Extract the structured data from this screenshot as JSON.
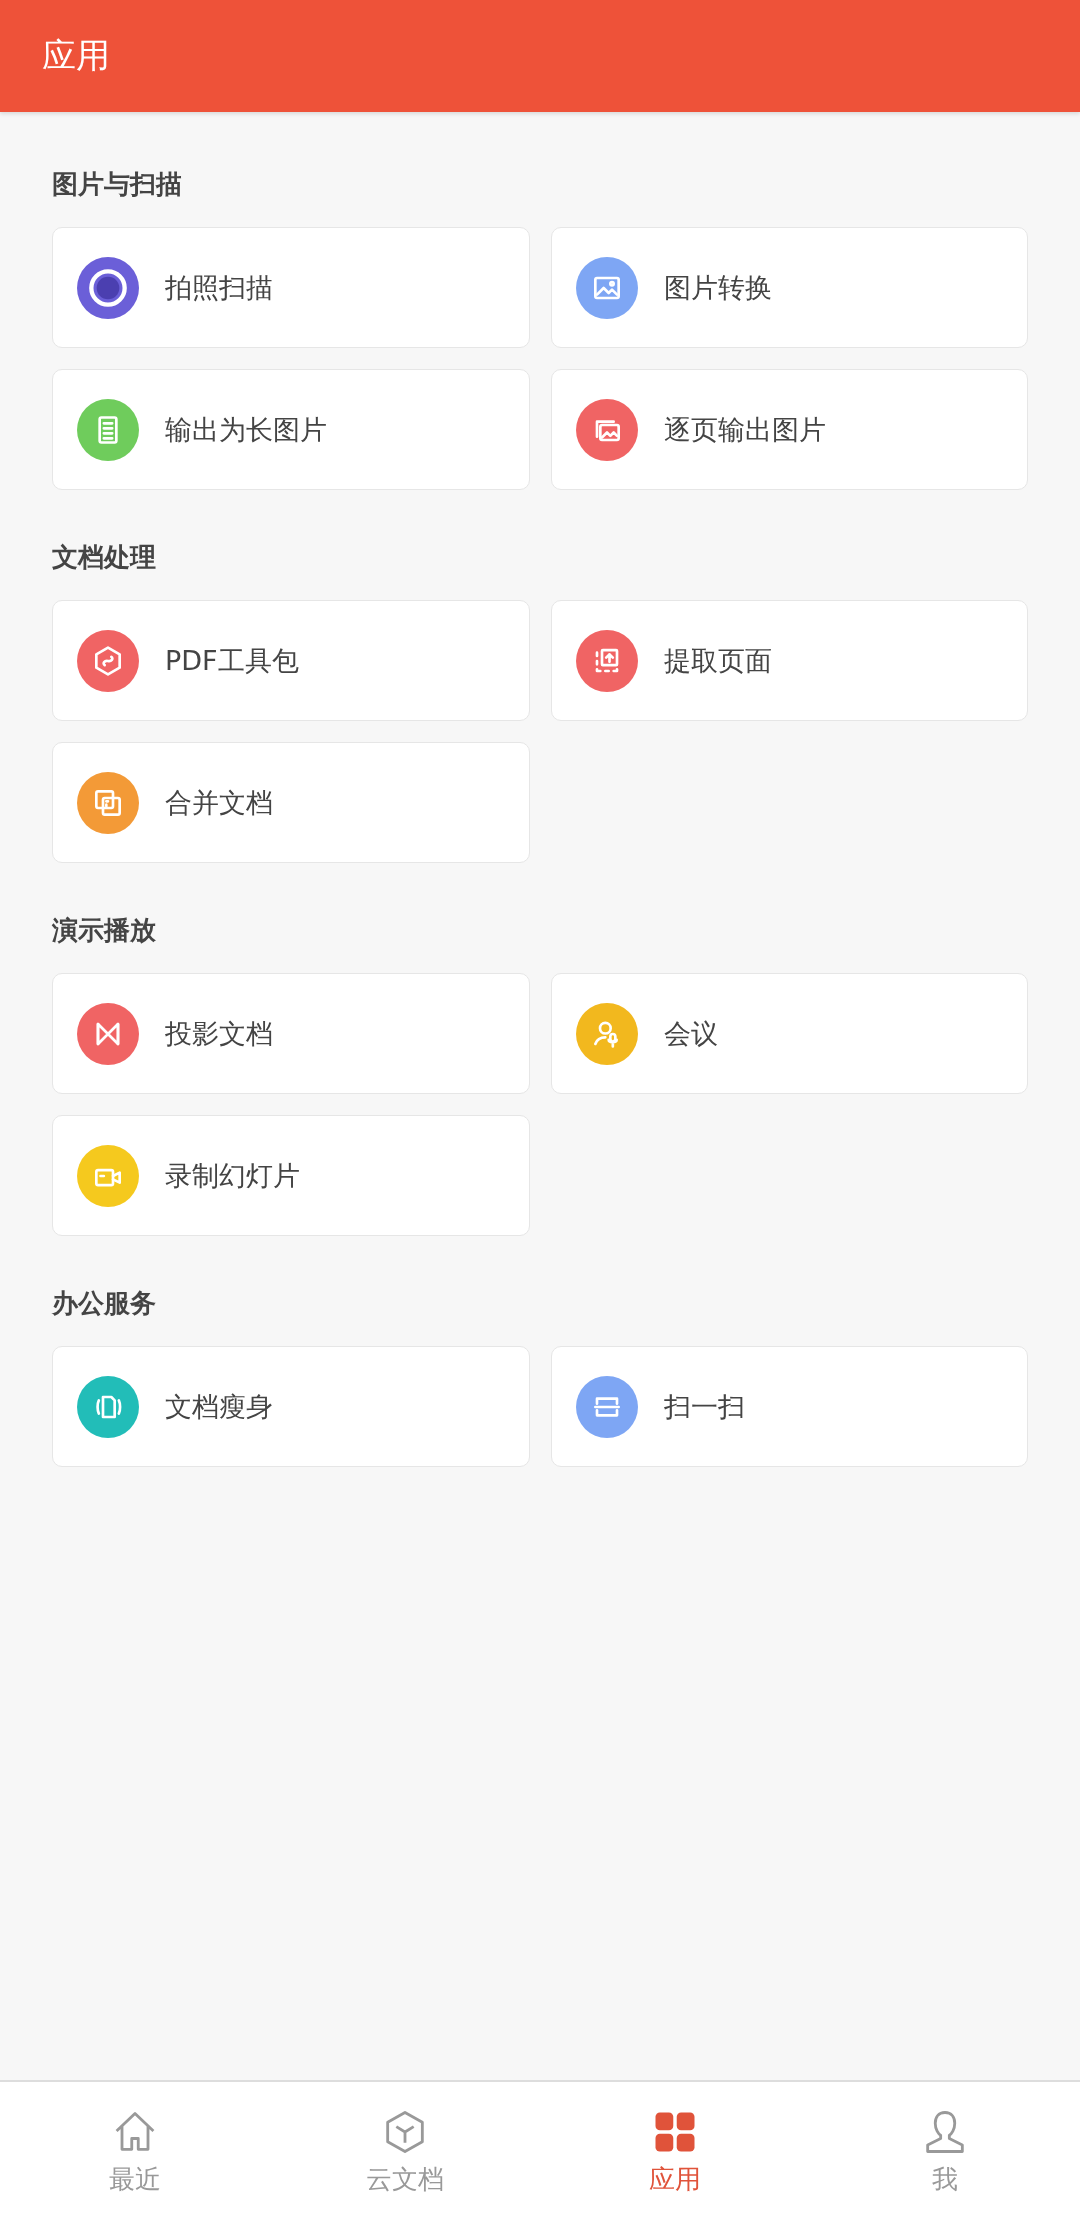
{
  "header": {
    "title": "应用"
  },
  "sections": [
    {
      "title": "图片与扫描",
      "items": [
        {
          "label": "拍照扫描",
          "kind": "target",
          "color": "#6b5fd8"
        },
        {
          "label": "图片转换",
          "kind": "image",
          "color": "#7ea6f4"
        },
        {
          "label": "输出为长图片",
          "kind": "longdoc",
          "color": "#6fcc5c"
        },
        {
          "label": "逐页输出图片",
          "kind": "images",
          "color": "#f06464"
        }
      ]
    },
    {
      "title": "文档处理",
      "items": [
        {
          "label": "PDF工具包",
          "kind": "hexagon",
          "color": "#f06464"
        },
        {
          "label": "提取页面",
          "kind": "extract",
          "color": "#f06464"
        },
        {
          "label": "合并文档",
          "kind": "merge",
          "color": "#f39a37"
        }
      ]
    },
    {
      "title": "演示播放",
      "items": [
        {
          "label": "投影文档",
          "kind": "bowtie",
          "color": "#f06464"
        },
        {
          "label": "会议",
          "kind": "personmic",
          "color": "#f2b81e"
        },
        {
          "label": "录制幻灯片",
          "kind": "video",
          "color": "#f5c91e"
        }
      ]
    },
    {
      "title": "办公服务",
      "items": [
        {
          "label": "文档瘦身",
          "kind": "slim",
          "color": "#22bdb8"
        },
        {
          "label": "扫一扫",
          "kind": "scan",
          "color": "#7ea6f4"
        }
      ]
    }
  ],
  "nav": [
    {
      "label": "最近",
      "kind": "home",
      "selected": false
    },
    {
      "label": "云文档",
      "kind": "cube",
      "selected": false
    },
    {
      "label": "应用",
      "kind": "grid",
      "selected": true
    },
    {
      "label": "我",
      "kind": "person",
      "selected": false
    }
  ]
}
